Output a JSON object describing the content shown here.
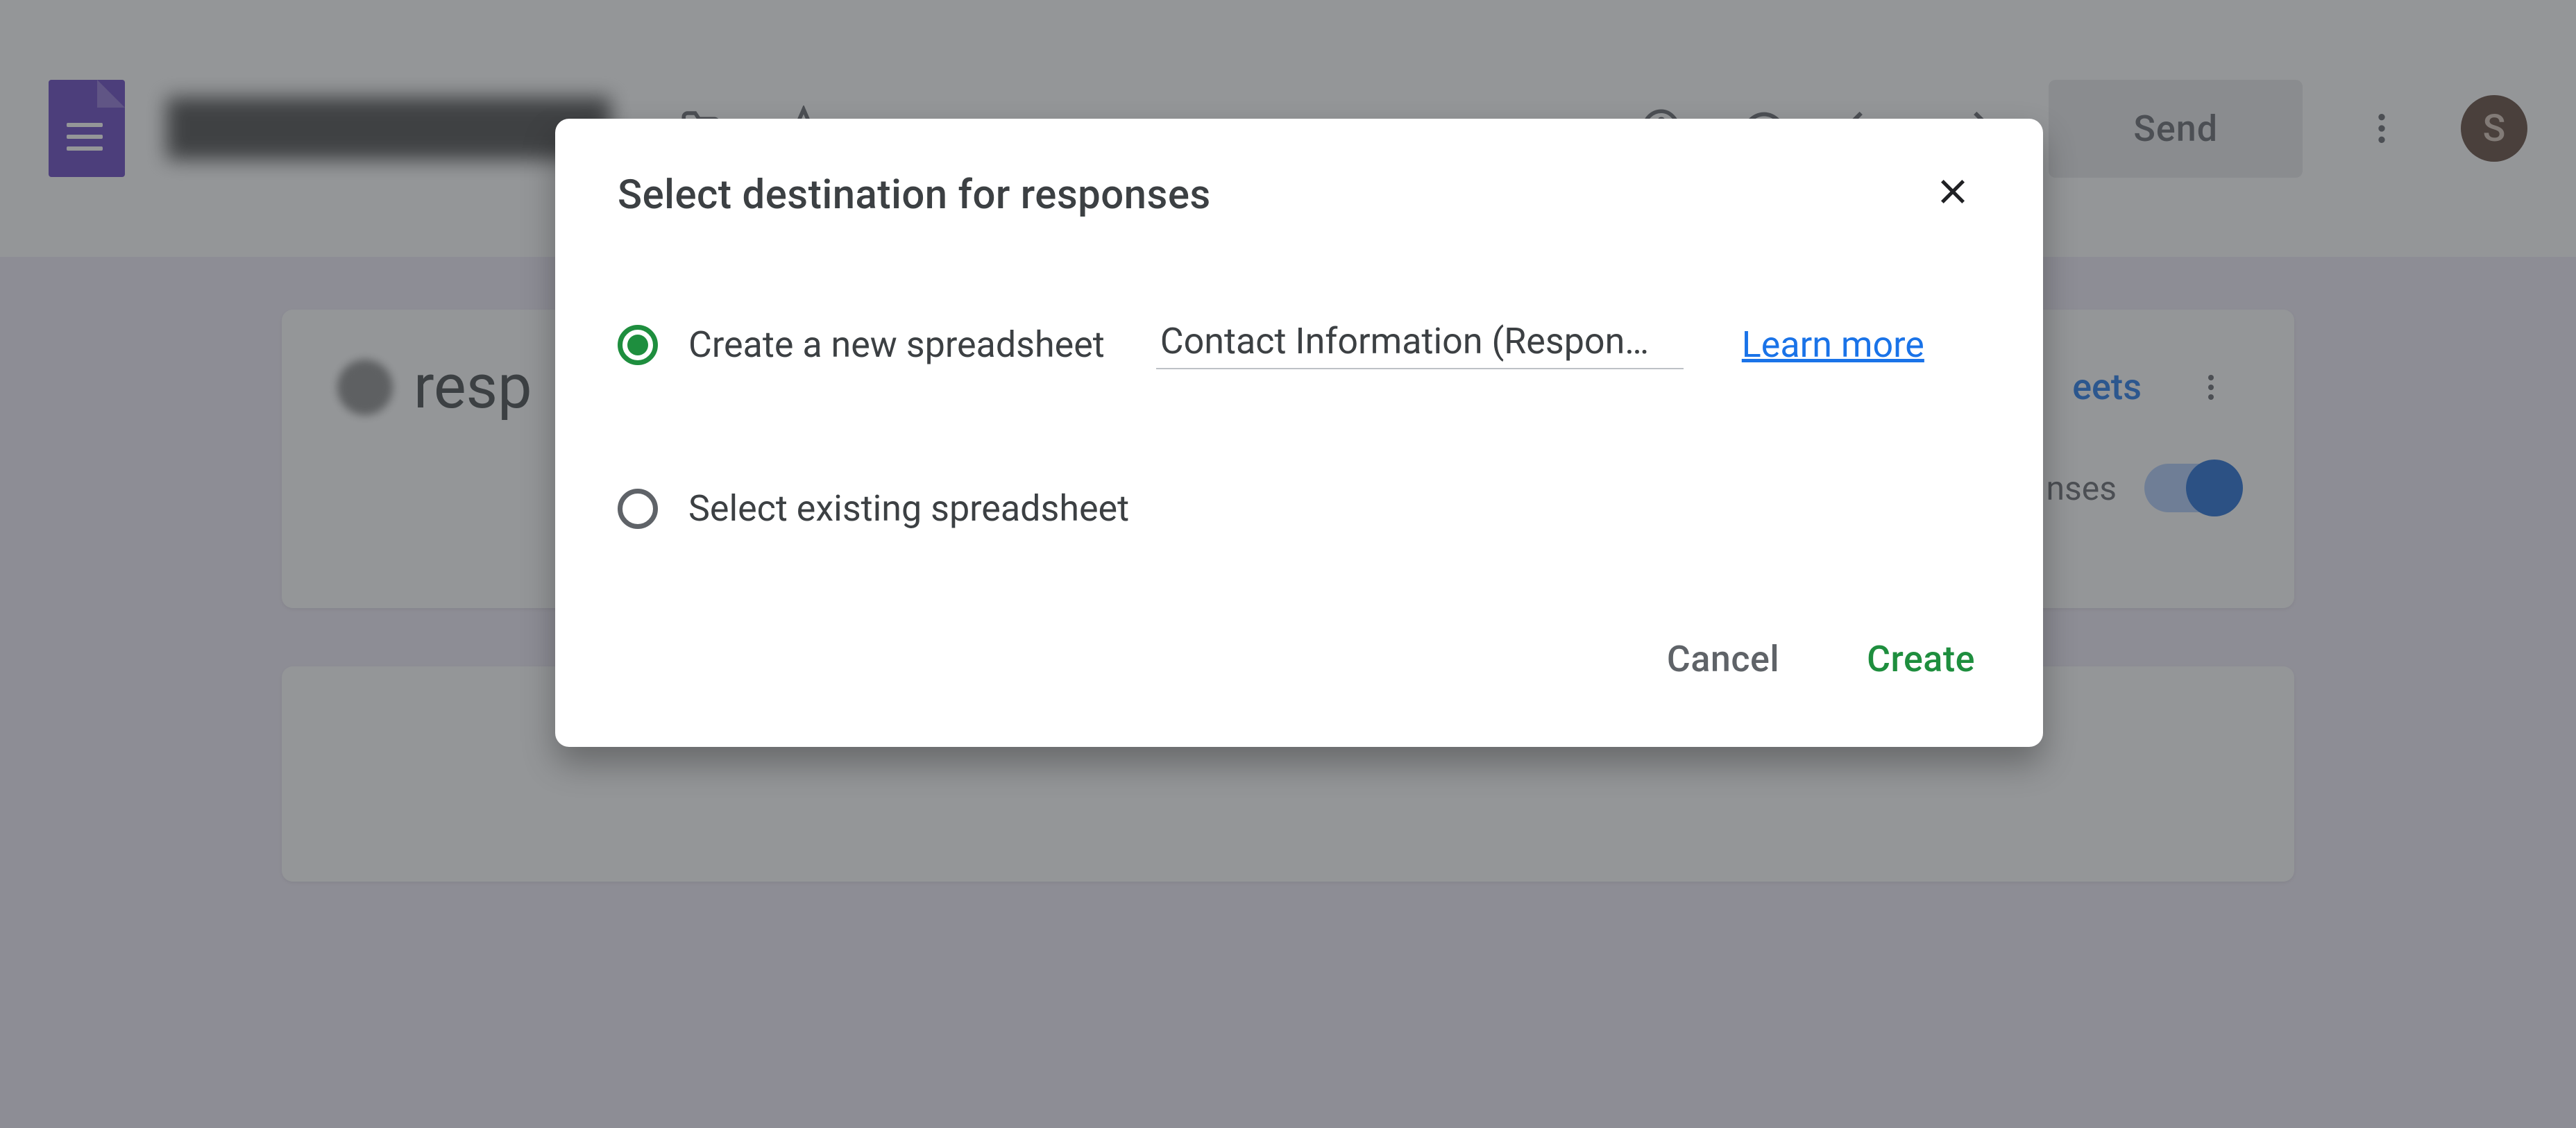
{
  "toolbar": {
    "form_title": "Contact Information",
    "send_label": "Send",
    "avatar_initial": "S",
    "icons": {
      "folder": "folder-icon",
      "star": "star-icon",
      "palette": "palette-icon",
      "preview": "preview-icon",
      "undo": "undo-icon",
      "redo": "redo-icon",
      "more": "more-icon"
    }
  },
  "responses_card": {
    "heading_fragment": "resp",
    "link_fragment": "eets",
    "accepting_fragment": "nses"
  },
  "dialog": {
    "title": "Select destination for responses",
    "options": {
      "create_new": {
        "label": "Create a new spreadsheet",
        "spreadsheet_name": "Contact Information (Respon…",
        "selected": true
      },
      "select_existing": {
        "label": "Select existing spreadsheet",
        "selected": false
      }
    },
    "learn_more": "Learn more",
    "actions": {
      "cancel": "Cancel",
      "create": "Create"
    }
  },
  "colors": {
    "accent_purple": "#673ab7",
    "accent_green": "#1e8e3e",
    "link_blue": "#1a73e8"
  }
}
